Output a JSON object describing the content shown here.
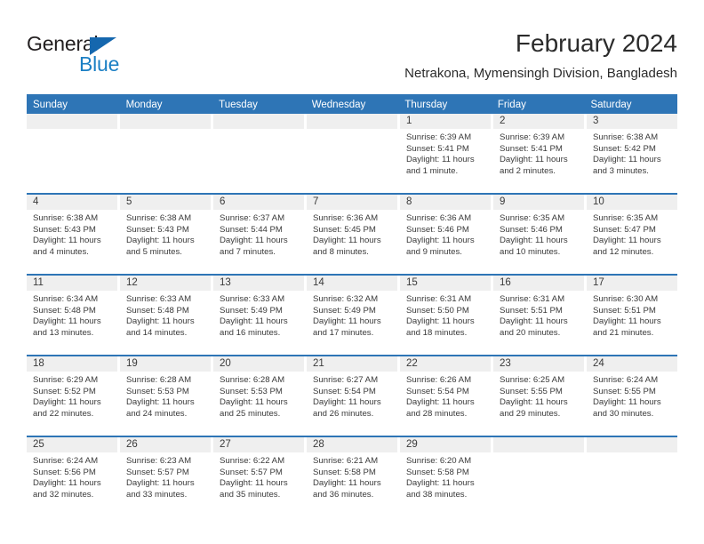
{
  "brand": {
    "word_one": "General",
    "word_two": "Blue",
    "triangle_icon": "triangle-icon",
    "accent_dark": "#1567ae",
    "accent_light": "#1b7fc4"
  },
  "header": {
    "title": "February 2024",
    "subtitle": "Netrakona, Mymensingh Division, Bangladesh"
  },
  "theme": {
    "header_blue": "#2e75b6",
    "day_band_gray": "#efefef",
    "text": "#3a3a3a"
  },
  "calendar": {
    "weekdays": [
      "Sunday",
      "Monday",
      "Tuesday",
      "Wednesday",
      "Thursday",
      "Friday",
      "Saturday"
    ],
    "weeks": [
      [
        {
          "day": "",
          "sunrise": "",
          "sunset": "",
          "daylight": "",
          "empty": true
        },
        {
          "day": "",
          "sunrise": "",
          "sunset": "",
          "daylight": "",
          "empty": true
        },
        {
          "day": "",
          "sunrise": "",
          "sunset": "",
          "daylight": "",
          "empty": true
        },
        {
          "day": "",
          "sunrise": "",
          "sunset": "",
          "daylight": "",
          "empty": true
        },
        {
          "day": "1",
          "sunrise": "Sunrise: 6:39 AM",
          "sunset": "Sunset: 5:41 PM",
          "daylight": "Daylight: 11 hours and 1 minute."
        },
        {
          "day": "2",
          "sunrise": "Sunrise: 6:39 AM",
          "sunset": "Sunset: 5:41 PM",
          "daylight": "Daylight: 11 hours and 2 minutes."
        },
        {
          "day": "3",
          "sunrise": "Sunrise: 6:38 AM",
          "sunset": "Sunset: 5:42 PM",
          "daylight": "Daylight: 11 hours and 3 minutes."
        }
      ],
      [
        {
          "day": "4",
          "sunrise": "Sunrise: 6:38 AM",
          "sunset": "Sunset: 5:43 PM",
          "daylight": "Daylight: 11 hours and 4 minutes."
        },
        {
          "day": "5",
          "sunrise": "Sunrise: 6:38 AM",
          "sunset": "Sunset: 5:43 PM",
          "daylight": "Daylight: 11 hours and 5 minutes."
        },
        {
          "day": "6",
          "sunrise": "Sunrise: 6:37 AM",
          "sunset": "Sunset: 5:44 PM",
          "daylight": "Daylight: 11 hours and 7 minutes."
        },
        {
          "day": "7",
          "sunrise": "Sunrise: 6:36 AM",
          "sunset": "Sunset: 5:45 PM",
          "daylight": "Daylight: 11 hours and 8 minutes."
        },
        {
          "day": "8",
          "sunrise": "Sunrise: 6:36 AM",
          "sunset": "Sunset: 5:46 PM",
          "daylight": "Daylight: 11 hours and 9 minutes."
        },
        {
          "day": "9",
          "sunrise": "Sunrise: 6:35 AM",
          "sunset": "Sunset: 5:46 PM",
          "daylight": "Daylight: 11 hours and 10 minutes."
        },
        {
          "day": "10",
          "sunrise": "Sunrise: 6:35 AM",
          "sunset": "Sunset: 5:47 PM",
          "daylight": "Daylight: 11 hours and 12 minutes."
        }
      ],
      [
        {
          "day": "11",
          "sunrise": "Sunrise: 6:34 AM",
          "sunset": "Sunset: 5:48 PM",
          "daylight": "Daylight: 11 hours and 13 minutes."
        },
        {
          "day": "12",
          "sunrise": "Sunrise: 6:33 AM",
          "sunset": "Sunset: 5:48 PM",
          "daylight": "Daylight: 11 hours and 14 minutes."
        },
        {
          "day": "13",
          "sunrise": "Sunrise: 6:33 AM",
          "sunset": "Sunset: 5:49 PM",
          "daylight": "Daylight: 11 hours and 16 minutes."
        },
        {
          "day": "14",
          "sunrise": "Sunrise: 6:32 AM",
          "sunset": "Sunset: 5:49 PM",
          "daylight": "Daylight: 11 hours and 17 minutes."
        },
        {
          "day": "15",
          "sunrise": "Sunrise: 6:31 AM",
          "sunset": "Sunset: 5:50 PM",
          "daylight": "Daylight: 11 hours and 18 minutes."
        },
        {
          "day": "16",
          "sunrise": "Sunrise: 6:31 AM",
          "sunset": "Sunset: 5:51 PM",
          "daylight": "Daylight: 11 hours and 20 minutes."
        },
        {
          "day": "17",
          "sunrise": "Sunrise: 6:30 AM",
          "sunset": "Sunset: 5:51 PM",
          "daylight": "Daylight: 11 hours and 21 minutes."
        }
      ],
      [
        {
          "day": "18",
          "sunrise": "Sunrise: 6:29 AM",
          "sunset": "Sunset: 5:52 PM",
          "daylight": "Daylight: 11 hours and 22 minutes."
        },
        {
          "day": "19",
          "sunrise": "Sunrise: 6:28 AM",
          "sunset": "Sunset: 5:53 PM",
          "daylight": "Daylight: 11 hours and 24 minutes."
        },
        {
          "day": "20",
          "sunrise": "Sunrise: 6:28 AM",
          "sunset": "Sunset: 5:53 PM",
          "daylight": "Daylight: 11 hours and 25 minutes."
        },
        {
          "day": "21",
          "sunrise": "Sunrise: 6:27 AM",
          "sunset": "Sunset: 5:54 PM",
          "daylight": "Daylight: 11 hours and 26 minutes."
        },
        {
          "day": "22",
          "sunrise": "Sunrise: 6:26 AM",
          "sunset": "Sunset: 5:54 PM",
          "daylight": "Daylight: 11 hours and 28 minutes."
        },
        {
          "day": "23",
          "sunrise": "Sunrise: 6:25 AM",
          "sunset": "Sunset: 5:55 PM",
          "daylight": "Daylight: 11 hours and 29 minutes."
        },
        {
          "day": "24",
          "sunrise": "Sunrise: 6:24 AM",
          "sunset": "Sunset: 5:55 PM",
          "daylight": "Daylight: 11 hours and 30 minutes."
        }
      ],
      [
        {
          "day": "25",
          "sunrise": "Sunrise: 6:24 AM",
          "sunset": "Sunset: 5:56 PM",
          "daylight": "Daylight: 11 hours and 32 minutes."
        },
        {
          "day": "26",
          "sunrise": "Sunrise: 6:23 AM",
          "sunset": "Sunset: 5:57 PM",
          "daylight": "Daylight: 11 hours and 33 minutes."
        },
        {
          "day": "27",
          "sunrise": "Sunrise: 6:22 AM",
          "sunset": "Sunset: 5:57 PM",
          "daylight": "Daylight: 11 hours and 35 minutes."
        },
        {
          "day": "28",
          "sunrise": "Sunrise: 6:21 AM",
          "sunset": "Sunset: 5:58 PM",
          "daylight": "Daylight: 11 hours and 36 minutes."
        },
        {
          "day": "29",
          "sunrise": "Sunrise: 6:20 AM",
          "sunset": "Sunset: 5:58 PM",
          "daylight": "Daylight: 11 hours and 38 minutes."
        },
        {
          "day": "",
          "sunrise": "",
          "sunset": "",
          "daylight": "",
          "empty": true
        },
        {
          "day": "",
          "sunrise": "",
          "sunset": "",
          "daylight": "",
          "empty": true
        }
      ]
    ]
  }
}
